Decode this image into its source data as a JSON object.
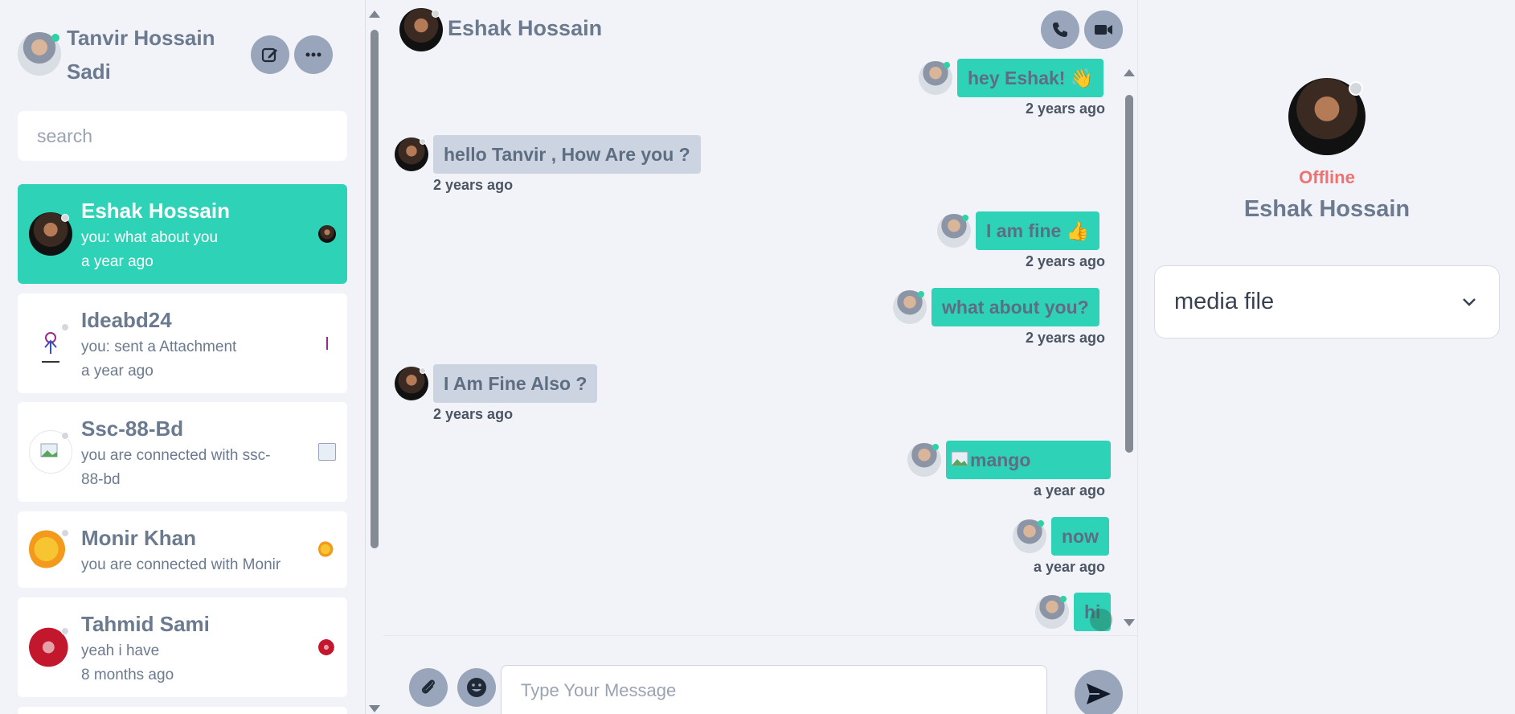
{
  "me": {
    "name": "Tanvir Hossain Sadi",
    "status": "online"
  },
  "sidebar": {
    "search_placeholder": "search",
    "contacts": [
      {
        "name": "Eshak Hossain",
        "last_message": "you: what about you",
        "time": "a year ago",
        "active": true,
        "status": "offline"
      },
      {
        "name": "Ideabd24",
        "last_message": "you: sent a Attachment",
        "time": "a year ago",
        "active": false,
        "status": "offline"
      },
      {
        "name": "Ssc-88-Bd",
        "last_message": "you are connected with ssc-",
        "last_message_2": "88-bd",
        "active": false,
        "status": "offline"
      },
      {
        "name": "Monir Khan",
        "last_message": "you are connected with Monir",
        "active": false,
        "status": "offline"
      },
      {
        "name": "Tahmid Sami",
        "last_message": "yeah i have",
        "time": "8 months ago",
        "active": false,
        "status": "offline"
      }
    ]
  },
  "chat": {
    "contact_name": "Eshak Hossain",
    "messages": [
      {
        "direction": "out",
        "text": "hey Eshak! 👋",
        "time": "2 years ago"
      },
      {
        "direction": "in",
        "text": "hello Tanvir , How Are you ?",
        "time": "2 years ago"
      },
      {
        "direction": "out",
        "text": "I am fine 👍",
        "time": "2 years ago"
      },
      {
        "direction": "out",
        "text": "what about you?",
        "time": "2 years ago"
      },
      {
        "direction": "in",
        "text": "I Am Fine Also ?",
        "time": "2 years ago"
      },
      {
        "direction": "out",
        "text": "mango",
        "time": "a year ago",
        "type": "image"
      },
      {
        "direction": "out",
        "text": "now",
        "time": "a year ago"
      },
      {
        "direction": "out",
        "text": "hi",
        "time": ""
      }
    ],
    "composer_placeholder": "Type Your Message"
  },
  "info_panel": {
    "status": "Offline",
    "name": "Eshak Hossain",
    "media_label": "media file"
  },
  "icons": [
    "edit-icon",
    "more-icon",
    "phone-icon",
    "video-icon",
    "attach-icon",
    "emoji-icon",
    "send-icon",
    "chevron-down-icon"
  ],
  "colors": {
    "accent": "#2ed3b7",
    "online": "#2ed3a5",
    "offline_text": "#f07171",
    "incoming_bubble": "#cbd4e0",
    "button": "#98a5ba"
  }
}
